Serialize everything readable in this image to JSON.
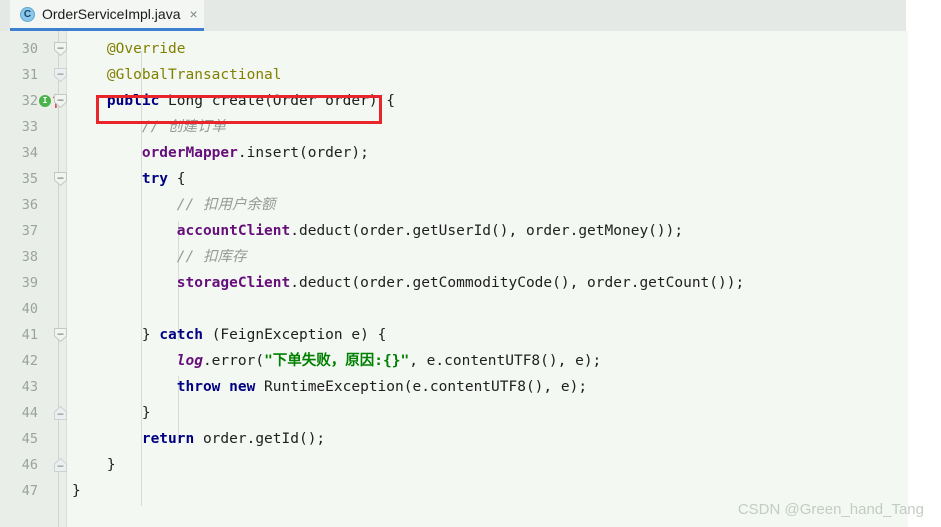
{
  "tab": {
    "icon": "java-class-icon",
    "label": "OrderServiceImpl.java",
    "close": "×"
  },
  "editor": {
    "first_line": 30,
    "background": "#f4f8f3",
    "gutter_background": "#eaeee9",
    "highlight_box_color": "#e8262a",
    "lines": [
      {
        "no": "30",
        "indent": 4,
        "fold": true,
        "impl": false
      },
      {
        "no": "31",
        "indent": 4,
        "fold": true,
        "impl": false
      },
      {
        "no": "32",
        "indent": 4,
        "fold": true,
        "impl": true
      },
      {
        "no": "33",
        "indent": 8,
        "fold": false,
        "impl": false
      },
      {
        "no": "34",
        "indent": 8,
        "fold": false,
        "impl": false
      },
      {
        "no": "35",
        "indent": 8,
        "fold": true,
        "impl": false
      },
      {
        "no": "36",
        "indent": 12,
        "fold": false,
        "impl": false
      },
      {
        "no": "37",
        "indent": 12,
        "fold": false,
        "impl": false
      },
      {
        "no": "38",
        "indent": 12,
        "fold": false,
        "impl": false
      },
      {
        "no": "39",
        "indent": 12,
        "fold": false,
        "impl": false
      },
      {
        "no": "40",
        "indent": 0,
        "fold": false,
        "impl": false
      },
      {
        "no": "41",
        "indent": 8,
        "fold": true,
        "impl": false
      },
      {
        "no": "42",
        "indent": 12,
        "fold": false,
        "impl": false
      },
      {
        "no": "43",
        "indent": 12,
        "fold": false,
        "impl": false
      },
      {
        "no": "44",
        "indent": 8,
        "fold": true,
        "impl": false
      },
      {
        "no": "45",
        "indent": 8,
        "fold": false,
        "impl": false
      },
      {
        "no": "46",
        "indent": 4,
        "fold": true,
        "impl": false
      },
      {
        "no": "47",
        "indent": 0,
        "fold": false,
        "impl": false
      }
    ],
    "code": {
      "l30": "    @Override",
      "l31": "    @GlobalTransactional",
      "l32_kw": "    public",
      "l32_rest": " Long create(Order order) {",
      "l33": "        // 创建订单",
      "l34_field": "        orderMapper",
      "l34_rest": ".insert(order);",
      "l35_kw": "        try",
      "l35_rest": " {",
      "l36": "            // 扣用户余额",
      "l37_field": "            accountClient",
      "l37_rest": ".deduct(order.getUserId(), order.getMoney());",
      "l38": "            // 扣库存",
      "l39_field": "            storageClient",
      "l39_rest": ".deduct(order.getCommodityCode(), order.getCount());",
      "l40": "",
      "l41_pre": "        } ",
      "l41_kw": "catch",
      "l41_rest": " (FeignException e) {",
      "l42_static": "            log",
      "l42_pre": ".error(",
      "l42_str": "\"下单失败，原因:{}\"",
      "l42_rest": ", e.contentUTF8(), e);",
      "l43_kw": "            throw new",
      "l43_rest": " RuntimeException(e.contentUTF8(), e);",
      "l44": "        }",
      "l45_kw": "        return",
      "l45_rest": " order.getId();",
      "l46": "    }",
      "l47": "}"
    }
  },
  "watermark": {
    "text": "CSDN @Green_hand_Tang"
  }
}
